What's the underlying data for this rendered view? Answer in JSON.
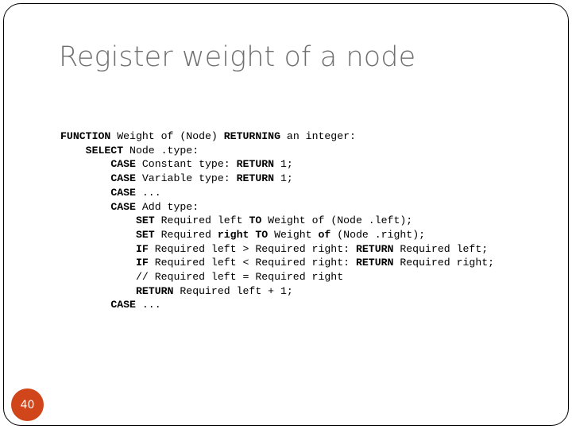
{
  "slide": {
    "title": "Register weight of a node",
    "number": "40",
    "accent_color": "#d1451b",
    "title_color": "#6f6f6f",
    "background_color": "#ffffff",
    "border_color": "#000000"
  },
  "code": {
    "language": "pseudocode",
    "lines": [
      [
        {
          "t": "FUNCTION",
          "b": true
        },
        {
          "t": " Weight of (Node) ",
          "b": false
        },
        {
          "t": "RETURNING",
          "b": true
        },
        {
          "t": " an integer:",
          "b": false
        }
      ],
      [
        {
          "t": "    ",
          "b": false
        },
        {
          "t": "SELECT",
          "b": true
        },
        {
          "t": " Node .type:",
          "b": false
        }
      ],
      [
        {
          "t": "        ",
          "b": false
        },
        {
          "t": "CASE",
          "b": true
        },
        {
          "t": " Constant type: ",
          "b": false
        },
        {
          "t": "RETURN",
          "b": true
        },
        {
          "t": " 1;",
          "b": false
        }
      ],
      [
        {
          "t": "        ",
          "b": false
        },
        {
          "t": "CASE",
          "b": true
        },
        {
          "t": " Variable type: ",
          "b": false
        },
        {
          "t": "RETURN",
          "b": true
        },
        {
          "t": " 1;",
          "b": false
        }
      ],
      [
        {
          "t": "        ",
          "b": false
        },
        {
          "t": "CASE",
          "b": true
        },
        {
          "t": " ...",
          "b": false
        }
      ],
      [
        {
          "t": "        ",
          "b": false
        },
        {
          "t": "CASE",
          "b": true
        },
        {
          "t": " Add type:",
          "b": false
        }
      ],
      [
        {
          "t": "            ",
          "b": false
        },
        {
          "t": "SET",
          "b": true
        },
        {
          "t": " Required left ",
          "b": false
        },
        {
          "t": "TO",
          "b": true
        },
        {
          "t": " Weight of (Node .left);",
          "b": false
        }
      ],
      [
        {
          "t": "            ",
          "b": false
        },
        {
          "t": "SET",
          "b": true
        },
        {
          "t": " Required ",
          "b": false
        },
        {
          "t": "right",
          "b": true
        },
        {
          "t": " ",
          "b": false
        },
        {
          "t": "TO",
          "b": true
        },
        {
          "t": " Weight ",
          "b": false
        },
        {
          "t": "of",
          "b": true
        },
        {
          "t": " (Node .right);",
          "b": false
        }
      ],
      [
        {
          "t": "            ",
          "b": false
        },
        {
          "t": "IF",
          "b": true
        },
        {
          "t": " Required left > Required right: ",
          "b": false
        },
        {
          "t": "RETURN",
          "b": true
        },
        {
          "t": " Required left;",
          "b": false
        }
      ],
      [
        {
          "t": "            ",
          "b": false
        },
        {
          "t": "IF",
          "b": true
        },
        {
          "t": " Required left < Required right: ",
          "b": false
        },
        {
          "t": "RETURN",
          "b": true
        },
        {
          "t": " Required right;",
          "b": false
        }
      ],
      [
        {
          "t": "            // Required left = Required right",
          "b": false
        }
      ],
      [
        {
          "t": "            ",
          "b": false
        },
        {
          "t": "RETURN",
          "b": true
        },
        {
          "t": " Required left + 1;",
          "b": false
        }
      ],
      [
        {
          "t": "        ",
          "b": false
        },
        {
          "t": "CASE",
          "b": true
        },
        {
          "t": " ...",
          "b": false
        }
      ]
    ]
  }
}
